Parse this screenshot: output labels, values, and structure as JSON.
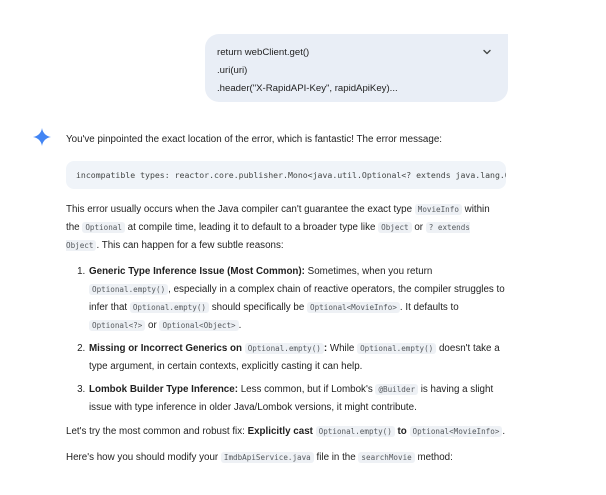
{
  "user_message": {
    "lines": [
      "return webClient.get()",
      ".uri(uri)",
      ".header(\"X-RapidAPI-Key\", rapidApiKey)..."
    ]
  },
  "response": {
    "intro": "You've pinpointed the exact location of the error, which is fantastic! The error message:",
    "error_code": "incompatible types: reactor.core.publisher.Mono<java.util.Optional<? extends java.lang.Object>>",
    "p1": {
      "t1": "This error usually occurs when the Java compiler can't guarantee the exact type ",
      "c1": "MovieInfo",
      "t2": " within the ",
      "c2": "Optional",
      "t3": " at compile time, leading it to default to a broader type like ",
      "c3": "Object",
      "t4": " or ",
      "c4": "? extends Object",
      "t5": ". This can happen for a few subtle reasons:"
    },
    "items": [
      {
        "title": "Generic Type Inference Issue (Most Common):",
        "t1": " Sometimes, when you return ",
        "c1": "Optional.empty()",
        "t2": ", especially in a complex chain of reactive operators, the compiler struggles to infer that ",
        "c2": "Optional.empty()",
        "t3": " should specifically be ",
        "c3": "Optional<MovieInfo>",
        "t4": ". It defaults to ",
        "c4": "Optional<?>",
        "t5": " or ",
        "c5": "Optional<Object>",
        "t6": "."
      },
      {
        "title": "Missing or Incorrect Generics on",
        "t0": " ",
        "c1": "Optional.empty()",
        "t1": ":",
        "t2": " While ",
        "c2": "Optional.empty()",
        "t3": " doesn't take a type argument, in certain contexts, explicitly casting it can help."
      },
      {
        "title": "Lombok Builder Type Inference:",
        "t1": " Less common, but if Lombok's ",
        "c1": "@Builder",
        "t2": " is having a slight issue with type inference in older Java/Lombok versions, it might contribute."
      }
    ],
    "fix": {
      "t1": "Let's try the most common and robust fix: ",
      "b1": "Explicitly cast",
      "c1": "Optional.empty()",
      "b2": "to",
      "c2": "Optional<MovieInfo>",
      "t2": "."
    },
    "howto": {
      "t1": "Here's how you should modify your ",
      "c1": "ImdbApiService.java",
      "t2": " file in the ",
      "c2": "searchMovie",
      "t3": " method:"
    }
  },
  "icons": {
    "expand": "chevron-down-icon",
    "assistant": "sparkle-icon"
  },
  "colors": {
    "bubble": "#e9eef6",
    "sparkle": "#4285f4",
    "code_bg": "#f0f4f9"
  }
}
